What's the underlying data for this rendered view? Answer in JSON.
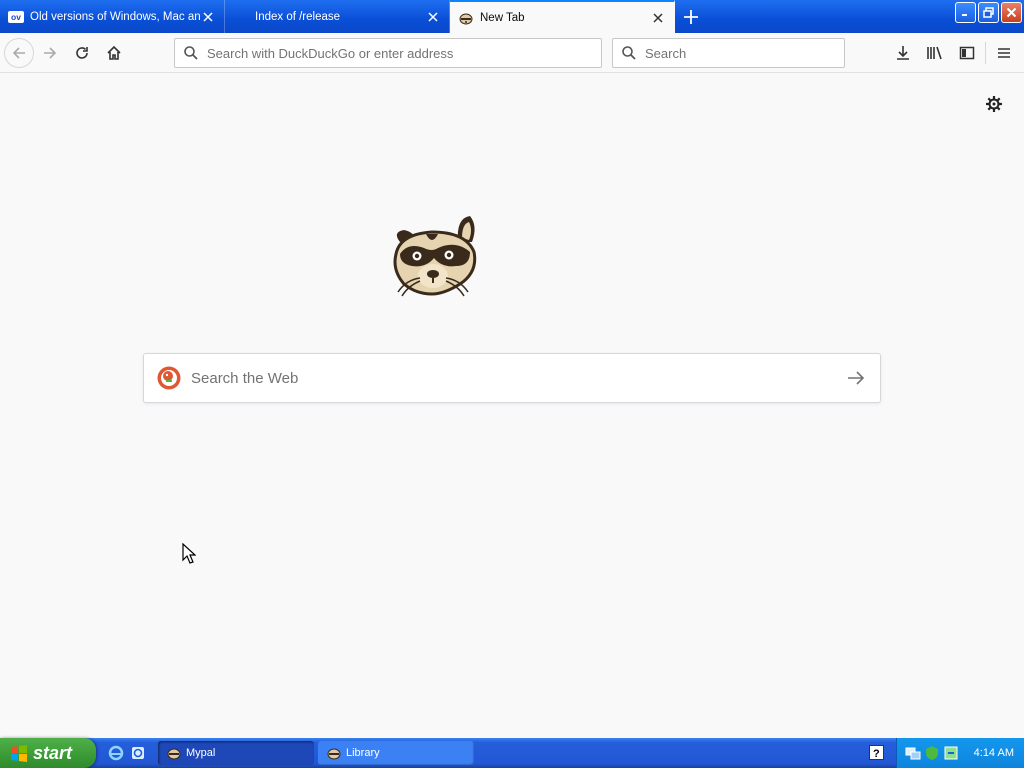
{
  "tabs": [
    {
      "label": "Old versions of Windows, Mac and",
      "favicon": "ov",
      "active": false
    },
    {
      "label": "Index of /release",
      "active": false
    },
    {
      "label": "New Tab",
      "active": true
    }
  ],
  "navbar": {
    "url_placeholder": "Search with DuckDuckGo or enter address",
    "search_placeholder": "Search"
  },
  "content": {
    "web_search_placeholder": "Search the Web"
  },
  "taskbar": {
    "start_label": "start",
    "tasks": [
      {
        "label": "Mypal",
        "active": true
      },
      {
        "label": "Library",
        "active": false
      }
    ],
    "clock": "4:14 AM"
  },
  "colors": {
    "titlebar": "#0a4fd6",
    "page_bg": "#f9f9fa",
    "taskbar": "#245edb",
    "start": "#3a9a36"
  }
}
